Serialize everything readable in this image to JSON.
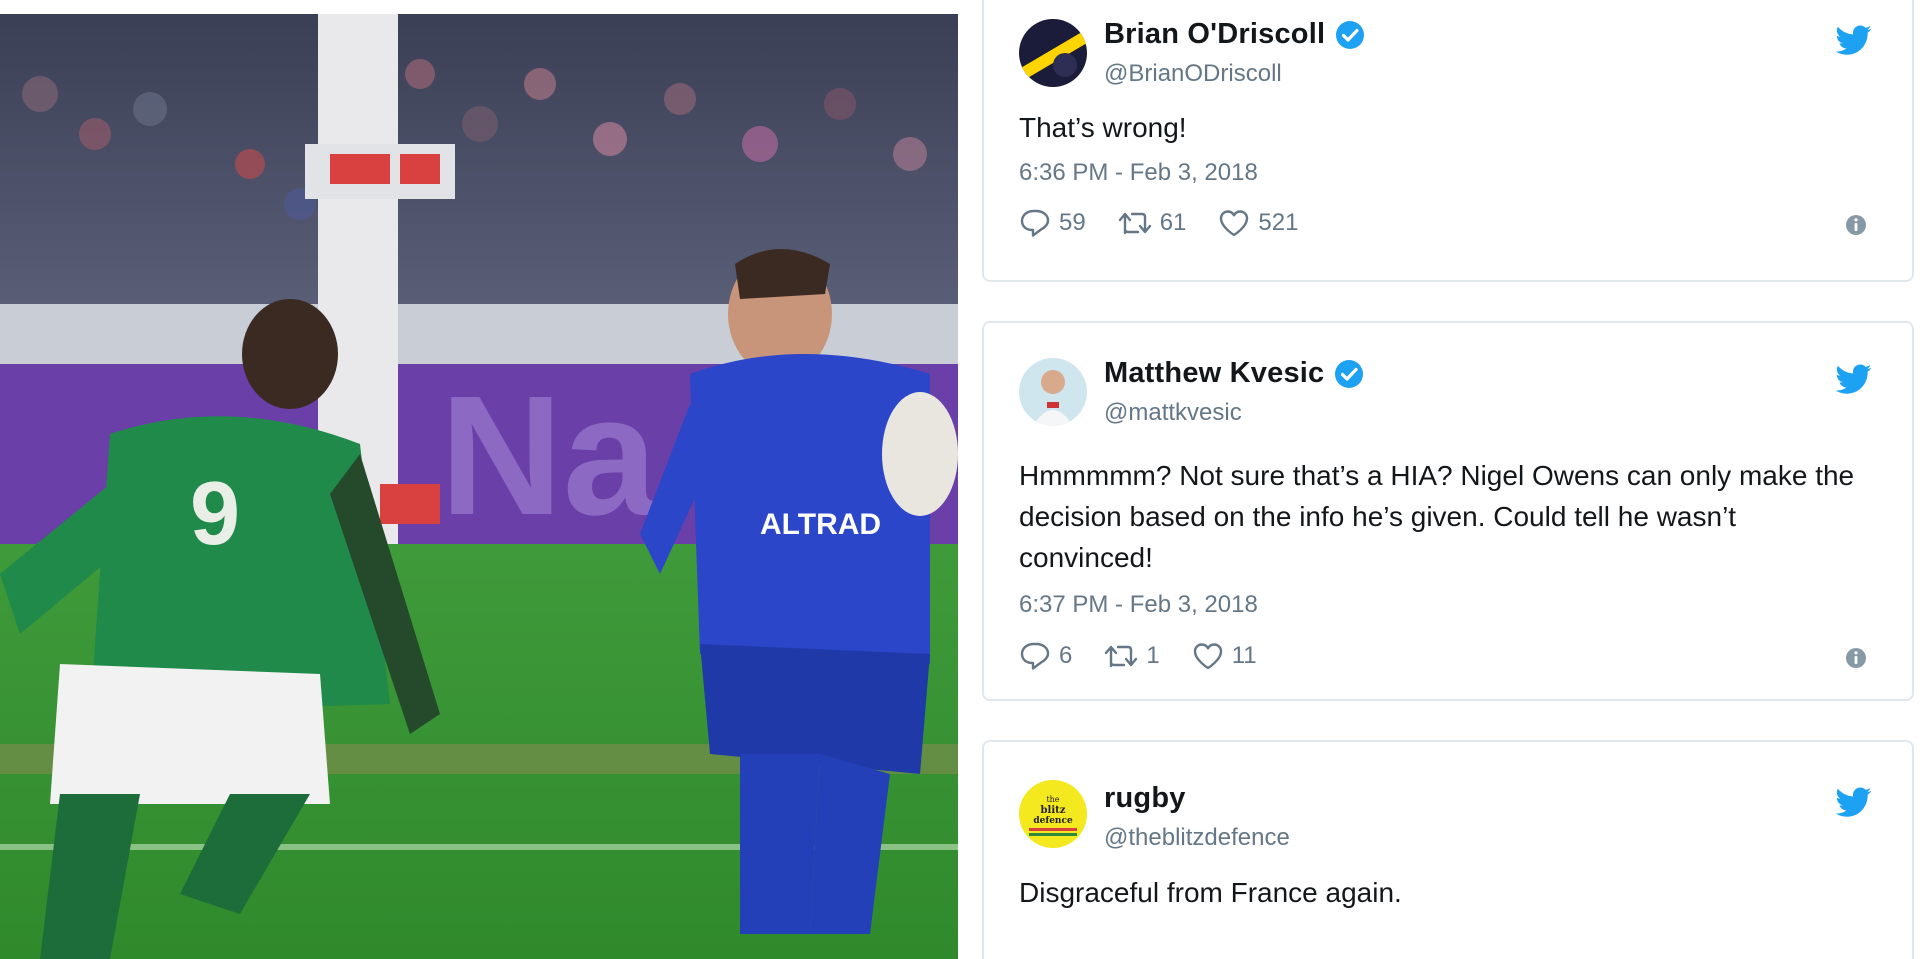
{
  "photo": {
    "jersey_text": "ALTRAD",
    "number": "9",
    "banner_text": "Na"
  },
  "tweets": [
    {
      "display_name": "Brian O'Driscoll",
      "handle": "@BrianODriscoll",
      "text": "That’s wrong!",
      "timestamp": "6:36 PM - Feb 3, 2018",
      "replies": "59",
      "retweets": "61",
      "likes": "521",
      "verified": true
    },
    {
      "display_name": "Matthew Kvesic",
      "handle": "@mattkvesic",
      "text": "Hmmmmm? Not sure that’s a HIA? Nigel Owens can only make the decision based on the info he’s given. Could tell he wasn’t convinced!",
      "timestamp": "6:37 PM - Feb 3, 2018",
      "replies": "6",
      "retweets": "1",
      "likes": "11",
      "verified": true
    },
    {
      "display_name": "rugby",
      "handle": "@theblitzdefence",
      "text": "Disgraceful from France again.",
      "verified": false,
      "avatar_text": "the blitz defence"
    }
  ],
  "colors": {
    "twitter_blue": "#1da1f2",
    "text_primary": "#14171a",
    "text_secondary": "#657786",
    "card_border": "#e1e8ed"
  },
  "icons": [
    "verified-badge-icon",
    "twitter-bird-icon",
    "reply-icon",
    "retweet-icon",
    "like-icon",
    "info-icon"
  ]
}
